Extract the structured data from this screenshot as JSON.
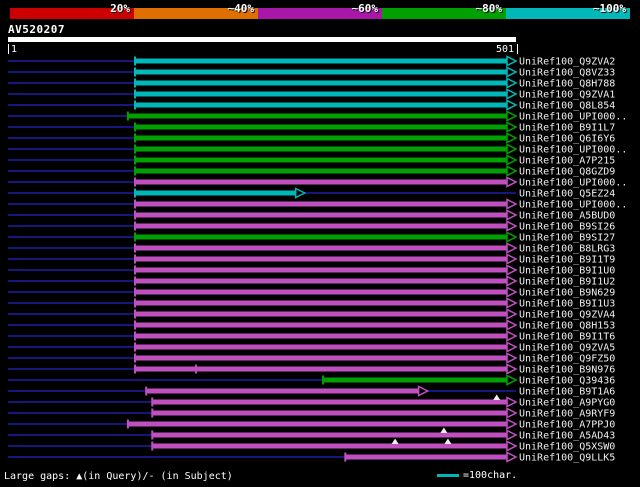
{
  "scale": {
    "segments": [
      {
        "label": "20%",
        "color": "#cc0000"
      },
      {
        "label": "~40%",
        "color": "#dd7000"
      },
      {
        "label": "~60%",
        "color": "#a818a8"
      },
      {
        "label": "~80%",
        "color": "#00a000"
      },
      {
        "label": "~100%",
        "color": "#00b8b8"
      }
    ]
  },
  "query": {
    "title": "AV520207"
  },
  "ruler": {
    "start": "1",
    "end": "501"
  },
  "footer": {
    "gaps_label": "Large gaps: ▲(in Query)/- (in Subject)",
    "scale_label": "=100char."
  },
  "colors": {
    "cyan": "#00b8b8",
    "green": "#00a000",
    "magenta": "#c050c0",
    "rowline": "#16167c",
    "marker": "#f0f0f0",
    "text": "#f0f0f0",
    "query_bar": "#ffffff"
  },
  "chart_data": {
    "type": "alignment-overview",
    "title": "BLAST graphical overview of UniRef100 hits",
    "query_name": "AV520207",
    "query_range": [
      1,
      501
    ],
    "identity_bins": [
      "20%",
      "~40%",
      "~60%",
      "~80%",
      "~100%"
    ],
    "legend_unit": "=100char.",
    "hits": [
      {
        "label": "UniRef100_Q9ZVA2",
        "color": "cyan",
        "start": 126,
        "end": 501
      },
      {
        "label": "UniRef100_Q8VZ33",
        "color": "cyan",
        "start": 126,
        "end": 501
      },
      {
        "label": "UniRef100_Q8H788",
        "color": "cyan",
        "start": 126,
        "end": 501
      },
      {
        "label": "UniRef100_Q9ZVA1",
        "color": "cyan",
        "start": 126,
        "end": 501
      },
      {
        "label": "UniRef100_Q8L854",
        "color": "cyan",
        "start": 126,
        "end": 501
      },
      {
        "label": "UniRef100_UPI000..",
        "color": "green",
        "start": 119,
        "end": 501
      },
      {
        "label": "UniRef100_B9I1L7",
        "color": "green",
        "start": 126,
        "end": 501
      },
      {
        "label": "UniRef100_Q6I6Y6",
        "color": "green",
        "start": 126,
        "end": 501
      },
      {
        "label": "UniRef100_UPI000..",
        "color": "green",
        "start": 126,
        "end": 501
      },
      {
        "label": "UniRef100_A7P215",
        "color": "green",
        "start": 126,
        "end": 501
      },
      {
        "label": "UniRef100_Q8GZD9",
        "color": "green",
        "start": 126,
        "end": 501
      },
      {
        "label": "UniRef100_UPI000..",
        "color": "magenta",
        "start": 126,
        "end": 501
      },
      {
        "label": "UniRef100_Q5EZ24",
        "color": "cyan",
        "start": 126,
        "end": 293
      },
      {
        "label": "UniRef100_UPI000..",
        "color": "magenta",
        "start": 126,
        "end": 501
      },
      {
        "label": "UniRef100_A5BUD0",
        "color": "magenta",
        "start": 126,
        "end": 501
      },
      {
        "label": "UniRef100_B9SI26",
        "color": "magenta",
        "start": 126,
        "end": 501
      },
      {
        "label": "UniRef100_B9SI27",
        "color": "green",
        "start": 126,
        "end": 501
      },
      {
        "label": "UniRef100_B8LRG3",
        "color": "magenta",
        "start": 126,
        "end": 501
      },
      {
        "label": "UniRef100_B9I1T9",
        "color": "magenta",
        "start": 126,
        "end": 501
      },
      {
        "label": "UniRef100_B9I1U0",
        "color": "magenta",
        "start": 126,
        "end": 501
      },
      {
        "label": "UniRef100_B9I1U2",
        "color": "magenta",
        "start": 126,
        "end": 501
      },
      {
        "label": "UniRef100_B9N629",
        "color": "magenta",
        "start": 126,
        "end": 501
      },
      {
        "label": "UniRef100_B9I1U3",
        "color": "magenta",
        "start": 126,
        "end": 501
      },
      {
        "label": "UniRef100_Q9ZVA4",
        "color": "magenta",
        "start": 126,
        "end": 501
      },
      {
        "label": "UniRef100_Q8H153",
        "color": "magenta",
        "start": 126,
        "end": 501
      },
      {
        "label": "UniRef100_B9I1T6",
        "color": "magenta",
        "start": 126,
        "end": 501
      },
      {
        "label": "UniRef100_Q9ZVA5",
        "color": "magenta",
        "start": 126,
        "end": 501
      },
      {
        "label": "UniRef100_Q9FZ50",
        "color": "magenta",
        "start": 126,
        "end": 501
      },
      {
        "label": "UniRef100_B9N976",
        "color": "magenta",
        "start": 126,
        "end": 501,
        "ticks": [
          186
        ]
      },
      {
        "label": "UniRef100_Q39436",
        "color": "green",
        "start": 311,
        "end": 501
      },
      {
        "label": "UniRef100_B9T1A6",
        "color": "magenta",
        "start": 137,
        "end": 414
      },
      {
        "label": "UniRef100_A9PYG0",
        "color": "magenta",
        "start": 143,
        "end": 501,
        "gap_triangles": [
          482
        ]
      },
      {
        "label": "UniRef100_A9RYF9",
        "color": "magenta",
        "start": 143,
        "end": 501
      },
      {
        "label": "UniRef100_A7PPJ0",
        "color": "magenta",
        "start": 119,
        "end": 501
      },
      {
        "label": "UniRef100_A5AD43",
        "color": "magenta",
        "start": 143,
        "end": 501,
        "gap_triangles": [
          430
        ]
      },
      {
        "label": "UniRef100_Q5XSW0",
        "color": "magenta",
        "start": 143,
        "end": 501,
        "gap_triangles": [
          382,
          434
        ]
      },
      {
        "label": "UniRef100_Q9LLK5",
        "color": "magenta",
        "start": 333,
        "end": 501
      }
    ]
  }
}
